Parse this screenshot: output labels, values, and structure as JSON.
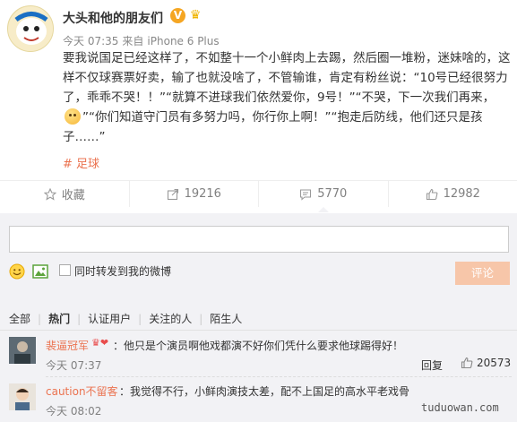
{
  "post": {
    "author": "大头和他的朋友们",
    "verified_badge": "V",
    "time": "今天 07:35",
    "source_prefix": "来自",
    "source": "iPhone 6 Plus",
    "text_part1": "要我说国足已经这样了，不如整十一个小鲜肉上去踢，然后圈一堆粉，迷妹啥的，这样不仅球赛票好卖，输了也就没啥了，不管输谁，肯定有粉丝说：“10号已经很努力了，乖乖不哭！！”“就算不进球我们依然爱你，9号！”“不哭，下一次我们再来，",
    "text_part2": "”“你们知道守门员有多努力吗，你行你上啊！”“抱走后防线，他们还只是孩子……”",
    "topic": "# 足球"
  },
  "actions": {
    "favorite": "收藏",
    "share_count": "19216",
    "comment_count": "5770",
    "like_count": "12982"
  },
  "comment_box": {
    "input_value": "",
    "forward_label": "同时转发到我的微博",
    "submit_label": "评论"
  },
  "filters": [
    "全部",
    "热门",
    "认证用户",
    "关注的人",
    "陌生人"
  ],
  "comments": [
    {
      "name": "裴逼冠军",
      "text": "：他只是个演员啊他戏都演不好你们凭什么要求他球踢得好！",
      "time": "今天 07:37",
      "reply": "回复",
      "likes": "20573"
    },
    {
      "name": "caution不留客",
      "text": "：我觉得不行，小鲜肉演技太差，配不上国足的高水平老戏骨",
      "time": "今天 08:02"
    }
  ],
  "watermark": "tuduowan.com",
  "colors": {
    "accent": "#eb7350",
    "submit_disabled": "#f7c6a9",
    "panel_bg": "#f2f2f5"
  }
}
